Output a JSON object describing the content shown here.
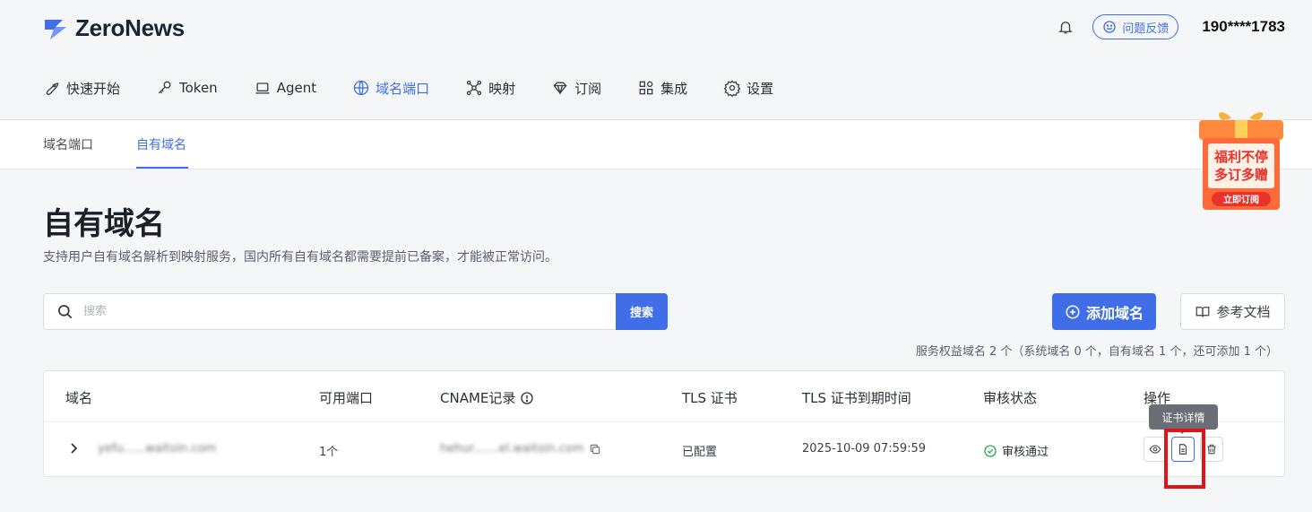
{
  "brand": {
    "name": "ZeroNews",
    "accent": "#3f6ee8"
  },
  "header": {
    "feedback_label": "问题反馈",
    "user_phone": "190****1783"
  },
  "nav": [
    {
      "label": "快速开始",
      "icon": "rocket-icon"
    },
    {
      "label": "Token",
      "icon": "key-icon"
    },
    {
      "label": "Agent",
      "icon": "laptop-icon"
    },
    {
      "label": "域名端口",
      "icon": "globe-icon",
      "active": true
    },
    {
      "label": "映射",
      "icon": "nodes-icon"
    },
    {
      "label": "订阅",
      "icon": "diamond-icon"
    },
    {
      "label": "集成",
      "icon": "grid-icon"
    },
    {
      "label": "设置",
      "icon": "gear-icon"
    }
  ],
  "subtabs": [
    {
      "label": "域名端口"
    },
    {
      "label": "自有域名",
      "active": true
    }
  ],
  "promo": {
    "line1": "福利不停",
    "line2": "多订多赠",
    "cta": "立即订阅"
  },
  "page": {
    "title": "自有域名",
    "description": "支持用户自有域名解析到映射服务，国内所有自有域名都需要提前已备案，才能被正常访问。"
  },
  "search": {
    "placeholder": "搜索",
    "button": "搜索"
  },
  "actions": {
    "add_label": "添加域名",
    "docs_label": "参考文档"
  },
  "quota_text": "服务权益域名 2 个（系统域名 0 个，自有域名 1 个，还可添加 1 个）",
  "table": {
    "columns": [
      "域名",
      "可用端口",
      "CNAME记录",
      "TLS 证书",
      "TLS 证书到期时间",
      "审核状态",
      "操作"
    ],
    "rows": [
      {
        "domain": "yefu......waitoin.com",
        "ports": "1个",
        "cname": "hehur.......el.waitoin.com",
        "tls": "已配置",
        "expires": "2025-10-09 07:59:59",
        "status": "审核通过"
      }
    ]
  },
  "tooltip": "证书详情"
}
